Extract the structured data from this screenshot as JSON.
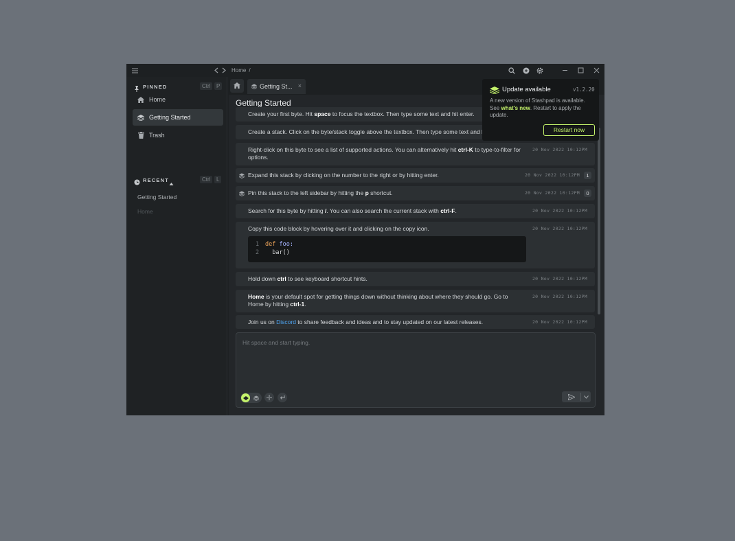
{
  "breadcrumb": {
    "home": "Home",
    "sep": "/"
  },
  "sidebar": {
    "pinned": {
      "title": "PINNED",
      "kbd_mod": "Ctrl",
      "kbd_key": "P"
    },
    "items": [
      {
        "label": "Home",
        "icon": "home-icon"
      },
      {
        "label": "Getting Started",
        "icon": "stack-icon"
      },
      {
        "label": "Trash",
        "icon": "trash-icon"
      }
    ],
    "recent": {
      "title": "RECENT",
      "kbd_mod": "Ctrl",
      "kbd_key": "L"
    },
    "recent_items": [
      "Getting Started",
      "Home"
    ]
  },
  "tabs": {
    "active_label": "Getting St...",
    "close": "×"
  },
  "stack": {
    "title": "Getting Started"
  },
  "bytes": [
    {
      "id": 0,
      "pre": "Create your first byte. Hit ",
      "b1": "space",
      "post": " to focus the textbox. Then type some text and hit enter.",
      "timestamp": ""
    },
    {
      "id": 1,
      "pre": "Create a stack. Click on the byte/stack toggle above the textbox. Then type some text and hit enter.",
      "timestamp": ""
    },
    {
      "id": 2,
      "pre": "Right-click on this byte to see a list of supported actions. You can alternatively hit ",
      "b1": "ctrl-K",
      "post": " to type-to-filter for options.",
      "timestamp": "20 Nov 2022 10:12PM"
    },
    {
      "id": 3,
      "pre": "Expand this stack by clicking on the number to the right or by hitting enter.",
      "timestamp": "20 Nov 2022 10:12PM",
      "count": "1"
    },
    {
      "id": 4,
      "pre": "Pin this stack to the left sidebar by hitting the ",
      "b1": "p",
      "post": " shortcut.",
      "timestamp": "20 Nov 2022 10:12PM",
      "count": "0"
    },
    {
      "id": 5,
      "pre": "Search for this byte by hitting ",
      "b1": "/",
      "mid": ". You can also search the current stack with ",
      "b2": "ctrl-F",
      "post": ".",
      "timestamp": "20 Nov 2022 10:12PM"
    },
    {
      "id": 6,
      "pre": "Copy this code block by hovering over it and clicking on the copy icon.",
      "timestamp": "20 Nov 2022 10:12PM",
      "code": [
        {
          "n": "1",
          "kw": "def",
          "fn": "foo",
          "rest": ":"
        },
        {
          "n": "2",
          "text": "  bar()"
        }
      ]
    },
    {
      "id": 7,
      "pre": "Hold down ",
      "b1": "ctrl",
      "post": " to see keyboard shortcut hints.",
      "timestamp": "20 Nov 2022 10:12PM"
    },
    {
      "id": 8,
      "b0": "Home",
      "pre": " is your default spot for getting things down without thinking about where they should go. Go to Home by hitting ",
      "b1": "ctrl-1",
      "post": ".",
      "timestamp": "20 Nov 2022 10:12PM"
    },
    {
      "id": 9,
      "pre": "Join us on ",
      "link": "Discord",
      "post": " to share feedback and ideas and to stay updated on our latest releases.",
      "timestamp": "20 Nov 2022 10:12PM"
    }
  ],
  "composer": {
    "placeholder": "Hit space and start typing."
  },
  "update": {
    "title": "Update available",
    "version": "v1.2.20",
    "body_pre": "A new version of Stashpad is available. See ",
    "body_link": "what's new",
    "body_post": ". Restart to apply the update.",
    "button": "Restart now"
  },
  "colors": {
    "accent": "#c4f26b",
    "link": "#4da3f0",
    "background": "#1d2022"
  }
}
